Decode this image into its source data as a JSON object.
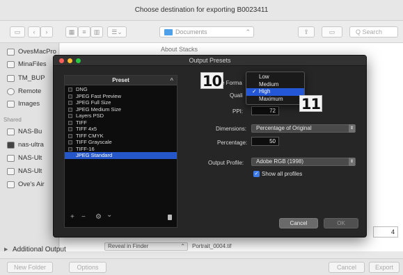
{
  "save_dialog": {
    "title": "Choose destination for exporting B0023411",
    "location": "Documents",
    "search_placeholder": "Q Search",
    "sidebar": {
      "items": [
        "OvesMacPro",
        "MinaFiles",
        "TM_BUP",
        "Remote",
        "Images"
      ],
      "shared_header": "Shared",
      "shared_items": [
        "NAS-Bu",
        "nas-ultra",
        "NAS-Ult",
        "NAS-Ult",
        "Ove's Air"
      ]
    },
    "file_item": "About Stacks",
    "number_field": "4",
    "additional_output": "Additional Output",
    "reveal_option": "Reveal in Finder",
    "filename": "Portrait_0004.tif",
    "buttons": {
      "new_folder": "New Folder",
      "options": "Options",
      "cancel": "Cancel",
      "export": "Export"
    }
  },
  "output_presets": {
    "title": "Output Presets",
    "preset_header": "Preset",
    "presets": [
      {
        "label": "DNG",
        "selected": false
      },
      {
        "label": "JPEG Fast Preview",
        "selected": false
      },
      {
        "label": "JPEG Full Size",
        "selected": false
      },
      {
        "label": "JPEG Medium Size",
        "selected": false
      },
      {
        "label": "Layers PSD",
        "selected": false
      },
      {
        "label": "TIFF",
        "selected": false
      },
      {
        "label": "TIFF 4x5",
        "selected": false
      },
      {
        "label": "TIFF CMYK",
        "selected": false
      },
      {
        "label": "TIFF Grayscale",
        "selected": false
      },
      {
        "label": "TIFF-16",
        "selected": false
      },
      {
        "label": "JPEG Standard",
        "selected": true
      }
    ],
    "tools": {
      "add": "+",
      "remove": "−",
      "gear": "⚙",
      "chevron": "⌄",
      "delete": "🗑"
    },
    "format_label": "e Forma",
    "quality_label": "Quali",
    "quality_options": [
      {
        "label": "Low",
        "selected": false
      },
      {
        "label": "Medium",
        "selected": false
      },
      {
        "label": "High",
        "selected": true
      },
      {
        "label": "Maximum",
        "selected": false
      }
    ],
    "check_mark": "✓",
    "ppi_label": "PPI:",
    "ppi_value": "72",
    "dimensions_label": "Dimensions:",
    "dimensions_value": "Percentage of Original",
    "percentage_label": "Percentage:",
    "percentage_value": "50",
    "output_profile_label": "Output Profile:",
    "output_profile_value": "Adobe RGB (1998)",
    "show_all_profiles": "Show all profiles",
    "cancel": "Cancel",
    "ok": "OK"
  },
  "annotations": {
    "badge_10": "10",
    "badge_11": "11"
  },
  "colors": {
    "sheet_bg": "#262626",
    "selection_blue": "#2557c9",
    "close": "#ff5f57",
    "minimize": "#febc2e",
    "zoom": "#28c840"
  }
}
